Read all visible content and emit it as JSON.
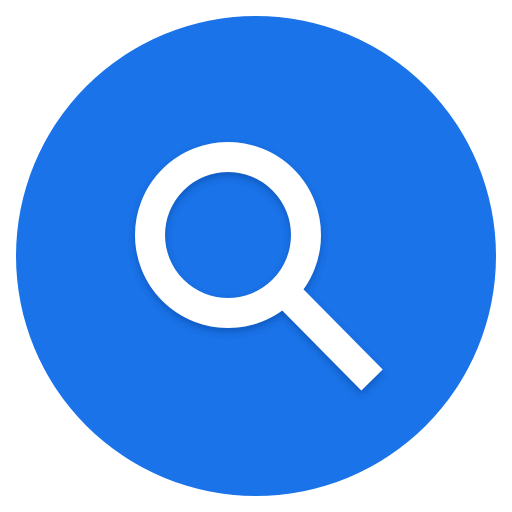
{
  "icon": {
    "name": "search-icon",
    "glyph": "magnifying-glass"
  },
  "colors": {
    "circle_fill": "#1a73e8",
    "glyph": "#ffffff",
    "shadow": "#0d47a1"
  }
}
